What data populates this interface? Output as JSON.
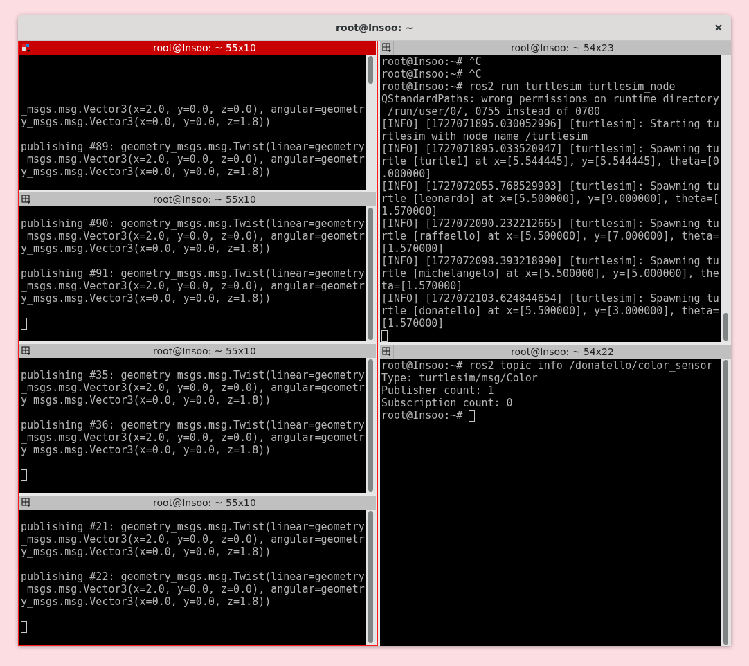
{
  "window": {
    "title": "root@Insoo: ~"
  },
  "columns": [
    {
      "grouped": true,
      "panes": [
        {
          "title": "root@Insoo: ~ 55x10",
          "focused": true,
          "cursor": false,
          "blocks": [
            [
              "_msgs.msg.Vector3(x=2.0, y=0.0, z=0.0), angular=geometr",
              "y_msgs.msg.Vector3(x=0.0, y=0.0, z=1.8))"
            ],
            [
              "publishing #89: geometry_msgs.msg.Twist(linear=geometry",
              "_msgs.msg.Vector3(x=2.0, y=0.0, z=0.0), angular=geometr",
              "y_msgs.msg.Vector3(x=0.0, y=0.0, z=1.8))"
            ]
          ]
        },
        {
          "title": "root@Insoo: ~ 55x10",
          "focused": false,
          "cursor": true,
          "blocks": [
            [
              "publishing #90: geometry_msgs.msg.Twist(linear=geometry",
              "_msgs.msg.Vector3(x=2.0, y=0.0, z=0.0), angular=geometr",
              "y_msgs.msg.Vector3(x=0.0, y=0.0, z=1.8))"
            ],
            [
              "publishing #91: geometry_msgs.msg.Twist(linear=geometry",
              "_msgs.msg.Vector3(x=2.0, y=0.0, z=0.0), angular=geometr",
              "y_msgs.msg.Vector3(x=0.0, y=0.0, z=1.8))"
            ]
          ]
        },
        {
          "title": "root@Insoo: ~ 55x10",
          "focused": false,
          "cursor": true,
          "blocks": [
            [
              "publishing #35: geometry_msgs.msg.Twist(linear=geometry",
              "_msgs.msg.Vector3(x=2.0, y=0.0, z=0.0), angular=geometr",
              "y_msgs.msg.Vector3(x=0.0, y=0.0, z=1.8))"
            ],
            [
              "publishing #36: geometry_msgs.msg.Twist(linear=geometry",
              "_msgs.msg.Vector3(x=2.0, y=0.0, z=0.0), angular=geometr",
              "y_msgs.msg.Vector3(x=0.0, y=0.0, z=1.8))"
            ]
          ]
        },
        {
          "title": "root@Insoo: ~ 55x10",
          "focused": false,
          "cursor": true,
          "blocks": [
            [
              "publishing #21: geometry_msgs.msg.Twist(linear=geometry",
              "_msgs.msg.Vector3(x=2.0, y=0.0, z=0.0), angular=geometr",
              "y_msgs.msg.Vector3(x=0.0, y=0.0, z=1.8))"
            ],
            [
              "publishing #22: geometry_msgs.msg.Twist(linear=geometry",
              "_msgs.msg.Vector3(x=2.0, y=0.0, z=0.0), angular=geometr",
              "y_msgs.msg.Vector3(x=0.0, y=0.0, z=1.8))"
            ]
          ]
        }
      ]
    },
    {
      "grouped": false,
      "panes": [
        {
          "title": "root@Insoo: ~ 54x23",
          "focused": false,
          "cursor": true,
          "blocks": [
            [
              "root@Insoo:~# ^C",
              "root@Insoo:~# ^C",
              "root@Insoo:~# ros2 run turtlesim turtlesim_node",
              "QStandardPaths: wrong permissions on runtime directory",
              " /run/user/0/, 0755 instead of 0700",
              "[INFO] [1727071895.030052996] [turtlesim]: Starting tu",
              "rtlesim with node name /turtlesim",
              "[INFO] [1727071895.033520947] [turtlesim]: Spawning tu",
              "rtle [turtle1] at x=[5.544445], y=[5.544445], theta=[0",
              ".000000]",
              "[INFO] [1727072055.768529903] [turtlesim]: Spawning tu",
              "rtle [leonardo] at x=[5.500000], y=[9.000000], theta=[",
              "1.570000]",
              "[INFO] [1727072090.232212665] [turtlesim]: Spawning tu",
              "rtle [raffaello] at x=[5.500000], y=[7.000000], theta=",
              "[1.570000]",
              "[INFO] [1727072098.393218990] [turtlesim]: Spawning tu",
              "rtle [michelangelo] at x=[5.500000], y=[5.000000], the",
              "ta=[1.570000]",
              "[INFO] [1727072103.624844654] [turtlesim]: Spawning tu",
              "rtle [donatello] at x=[5.500000], y=[3.000000], theta=",
              "[1.570000]"
            ]
          ]
        },
        {
          "title": "root@Insoo: ~ 54x22",
          "focused": false,
          "cursor": true,
          "blocks": [
            [
              "root@Insoo:~# ros2 topic info /donatello/color_sensor",
              "Type: turtlesim/msg/Color",
              "Publisher count: 1",
              "Subscription count: 0"
            ]
          ],
          "prompt": "root@Insoo:~#"
        }
      ]
    }
  ]
}
